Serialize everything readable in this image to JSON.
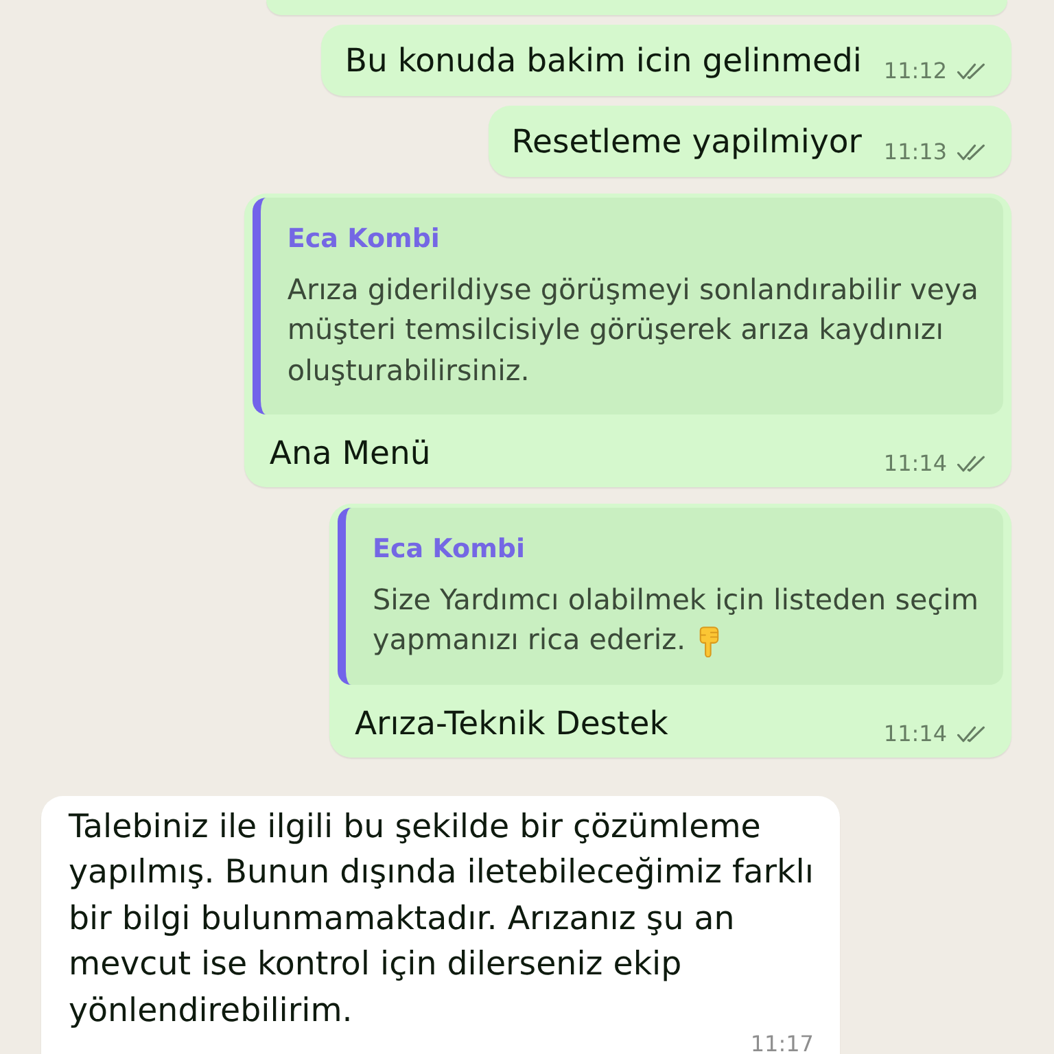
{
  "chat": {
    "messages": [
      {
        "kind": "clipped",
        "outgoing": true
      },
      {
        "kind": "text",
        "outgoing": true,
        "text": "Bu konuda bakim icin gelinmedi",
        "time": "11:12",
        "read": false
      },
      {
        "kind": "text",
        "outgoing": true,
        "text": "Resetleme yapilmiyor",
        "time": "11:13",
        "read": false
      },
      {
        "kind": "reply",
        "outgoing": true,
        "quote": {
          "author": "Eca Kombi",
          "text": "Arıza giderildiyse görüşmeyi sonlandırabilir veya\nmüşteri temsilcisiyle görüşerek arıza kaydınızı\noluşturabilirsiniz.",
          "trailing_emoji": false
        },
        "text": "Ana Menü",
        "time": "11:14",
        "read": false
      },
      {
        "kind": "reply",
        "outgoing": true,
        "quote": {
          "author": "Eca Kombi",
          "text": "Size Yardımcı olabilmek için listeden seçim\nyapmanızı rica ederiz.",
          "trailing_emoji": true
        },
        "text": "Arıza-Teknik Destek",
        "time": "11:14",
        "read": false
      },
      {
        "kind": "text",
        "outgoing": false,
        "text": "Talebiniz ile ilgili bu şekilde bir çözümleme\nyapılmış. Bunun dışında iletebileceğimiz farklı\nbir bilgi bulunmamaktadır. Arızanız şu an\nmevcut ise kontrol için dilerseniz ekip\nyönlendirebilirim.",
        "time": "11:17"
      }
    ]
  }
}
